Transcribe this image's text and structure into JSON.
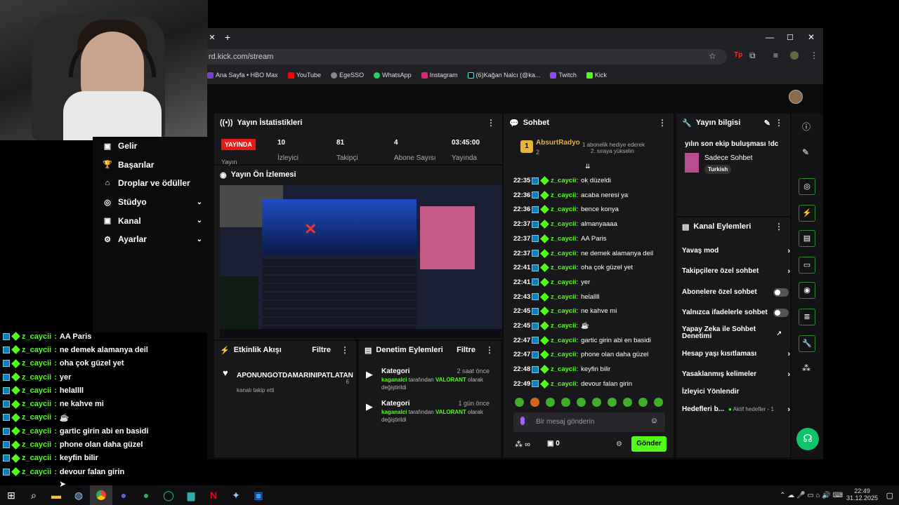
{
  "browser": {
    "url": "rd.kick.com/stream",
    "bookmarks": [
      "Ana Sayfa • HBO Max",
      "YouTube",
      "EgeSSO",
      "WhatsApp",
      "Instagram",
      "(6)Kağan Nalcı (@ka...",
      "Twitch",
      "Kick"
    ]
  },
  "nav": {
    "items": [
      {
        "label": "Gelir",
        "icon": "money-icon",
        "chevron": false
      },
      {
        "label": "Başarılar",
        "icon": "trophy-icon",
        "chevron": false
      },
      {
        "label": "Droplar ve ödüller",
        "icon": "gift-icon",
        "chevron": false
      },
      {
        "label": "Stüdyo",
        "icon": "studio-icon",
        "chevron": true
      },
      {
        "label": "Kanal",
        "icon": "channel-icon",
        "chevron": true
      },
      {
        "label": "Ayarlar",
        "icon": "gear-icon",
        "chevron": true
      }
    ]
  },
  "overlay_chat": [
    {
      "user": "z_caycii",
      "msg": "AA Paris"
    },
    {
      "user": "z_caycii",
      "msg": "ne demek alamanya deil"
    },
    {
      "user": "z_caycii",
      "msg": "oha çok güzel yet"
    },
    {
      "user": "z_caycii",
      "msg": "yer"
    },
    {
      "user": "z_caycii",
      "msg": "helallll"
    },
    {
      "user": "z_caycii",
      "msg": "ne kahve mi"
    },
    {
      "user": "z_caycii",
      "msg": "☕"
    },
    {
      "user": "z_caycii",
      "msg": "gartic girin abi en basidi"
    },
    {
      "user": "z_caycii",
      "msg": "phone olan daha güzel"
    },
    {
      "user": "z_caycii",
      "msg": "keyfin bilir"
    },
    {
      "user": "z_caycii",
      "msg": "devour falan girin"
    }
  ],
  "stats": {
    "title": "Yayın İstatistikleri",
    "live_label": "YAYINDA",
    "items": [
      {
        "value": "10",
        "label": "İzleyici"
      },
      {
        "value": "81",
        "label": "Takipçi"
      },
      {
        "value": "4",
        "label": "Abone Sayısı"
      },
      {
        "value": "03:45:00",
        "label": "Yayında"
      }
    ],
    "extra_label": "Yayın"
  },
  "preview": {
    "title": "Yayın Ön İzlemesi"
  },
  "activity": {
    "title": "Etkinlik Akışı",
    "filter": "Filtre",
    "item_user": "APONUNGOTDAMARINIPATLATAN",
    "item_text": "kanalı takip etti",
    "item_count": "6"
  },
  "moderation": {
    "title": "Denetim Eylemleri",
    "filter": "Filtre",
    "items": [
      {
        "title": "Kategori",
        "time": "2 saat önce",
        "user": "kaganalci",
        "mid": " tarafından ",
        "game": "VALORANT",
        "tail": " olarak",
        "line2": "değiştirildi"
      },
      {
        "title": "Kategori",
        "time": "1 gün önce",
        "user": "kaganalci",
        "mid": " tarafından ",
        "game": "VALORANT",
        "tail": " olarak",
        "line2": "değiştirildi"
      }
    ]
  },
  "chat": {
    "title": "Sohbet",
    "pinned_user": "AbsurtRadyo",
    "pinned_rank": "1",
    "pinned_count": "2",
    "gift_line1": "1 abonelik hediye ederek",
    "gift_line2": "2. sıraya yükselin",
    "messages": [
      {
        "time": "22:35",
        "user": "z_caycii",
        "msg": "ok düzeldi"
      },
      {
        "time": "22:36",
        "user": "z_caycii",
        "msg": "acaba neresi ya"
      },
      {
        "time": "22:36",
        "user": "z_caycii",
        "msg": "bence konya"
      },
      {
        "time": "22:37",
        "user": "z_caycii",
        "msg": "almanyaaaa"
      },
      {
        "time": "22:37",
        "user": "z_caycii",
        "msg": "AA Paris"
      },
      {
        "time": "22:37",
        "user": "z_caycii",
        "msg": "ne demek alamanya deil"
      },
      {
        "time": "22:41",
        "user": "z_caycii",
        "msg": "oha çok güzel yet"
      },
      {
        "time": "22:41",
        "user": "z_caycii",
        "msg": "yer"
      },
      {
        "time": "22:43",
        "user": "z_caycii",
        "msg": "helallll"
      },
      {
        "time": "22:45",
        "user": "z_caycii",
        "msg": "ne kahve mi"
      },
      {
        "time": "22:45",
        "user": "z_caycii",
        "msg": "☕"
      },
      {
        "time": "22:47",
        "user": "z_caycii",
        "msg": "gartic girin abi en basidi"
      },
      {
        "time": "22:47",
        "user": "z_caycii",
        "msg": "phone olan daha güzel"
      },
      {
        "time": "22:48",
        "user": "z_caycii",
        "msg": "keyfin bilir"
      },
      {
        "time": "22:49",
        "user": "z_caycii",
        "msg": "devour falan girin"
      }
    ],
    "input_placeholder": "Bir mesaj gönderin",
    "infinity": "∞",
    "points": "0",
    "send": "Gönder"
  },
  "info": {
    "title": "Yayın bilgisi",
    "stream_title": "yılın son ekip buluşması !dc",
    "category": "Sadece Sohbet",
    "tag": "Turkish"
  },
  "channel_actions": {
    "title": "Kanal Eylemleri",
    "rows": [
      {
        "label": "Yavaş mod",
        "type": "chevron"
      },
      {
        "label": "Takipçilere özel sohbet",
        "type": "chevron"
      },
      {
        "label": "Abonelere özel sohbet",
        "type": "toggle"
      },
      {
        "label": "Yalnızca ifadelerle sohbet",
        "type": "toggle"
      },
      {
        "label": "Yapay Zeka ile Sohbet Denetimi",
        "type": "link"
      },
      {
        "label": "Hesap yaşı kısıtlaması",
        "type": "chevron"
      },
      {
        "label": "Yasaklanmış kelimeler",
        "type": "chevron"
      },
      {
        "label": "İzleyici Yönlendir",
        "type": "none"
      }
    ],
    "goals_label": "Hedefleri b...",
    "goals_status": "Aktif hedefler - 1"
  },
  "taskbar": {
    "time": "22:49",
    "date": "31.12.2025"
  },
  "colors": {
    "kick_green": "#53fc18",
    "panel": "#18181b",
    "live_red": "#e91916",
    "bg": "#0b0b0c"
  }
}
